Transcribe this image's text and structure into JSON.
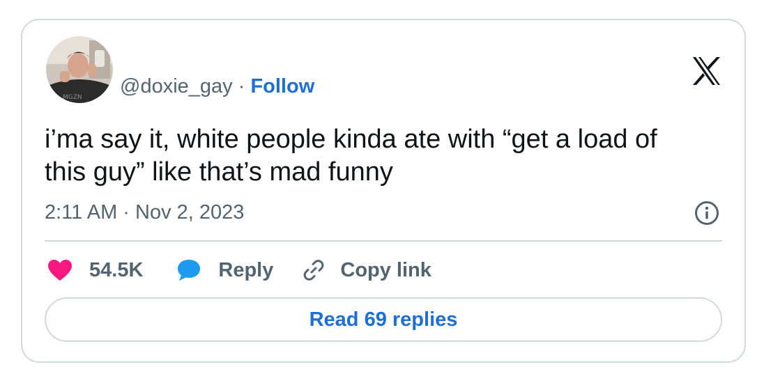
{
  "author": {
    "handle": "@doxie_gay",
    "separator": " · ",
    "follow_label": "Follow"
  },
  "platform_logo": "x-logo-icon",
  "tweet": {
    "text_line1": "i’ma say it, white people kinda ate with “get a load of",
    "text_line2": "this guy” like that’s mad funny",
    "timestamp": "2:11 AM · Nov 2, 2023"
  },
  "actions": {
    "likes_count": "54.5K",
    "reply_label": "Reply",
    "copy_link_label": "Copy link"
  },
  "read_replies_label": "Read 69 replies",
  "colors": {
    "like": "#f91880",
    "reply": "#1d9bf0",
    "link": "#1d6fd6",
    "muted": "#536471",
    "border": "#cfd9de"
  }
}
